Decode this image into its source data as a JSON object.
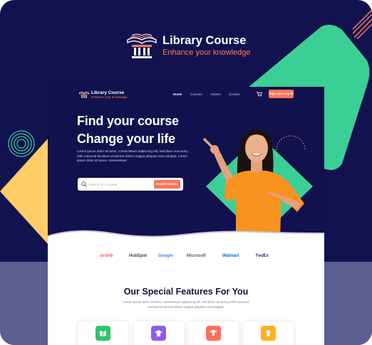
{
  "brand": {
    "title": "Library Course",
    "tagline": "Enhance your knowledge"
  },
  "site": {
    "logo_title": "Library Course",
    "logo_tagline": "Enhance your knowledge",
    "nav": [
      {
        "label": "Home",
        "active": true
      },
      {
        "label": "Courses",
        "active": false
      },
      {
        "label": "Articles",
        "active": false
      },
      {
        "label": "Contact",
        "active": false
      }
    ],
    "cart_icon": "cart-icon",
    "signup_label": "Sign Up / Log In",
    "hero": {
      "headline_line1": "Find your course",
      "headline_line2": "Change your life",
      "description": "Lorem ipsum dolor sit amet, consectetuer adipiscing elit, sed diam nonummy nibh euismod tincidunt ut laoreet dolore magna aliquam erat volutpat. Lorem ipsum dolor sit amet, consectetuer."
    },
    "search": {
      "placeholder": "Search for a course",
      "button_label": "Search Course"
    },
    "partners": [
      "airbnb",
      "HubSpot",
      "Google",
      "Microsoft",
      "Walmart",
      "FedEx"
    ],
    "features": {
      "title": "Our Special Features For You",
      "description": "Lorem ipsum dolor sit amet, consectetuer adipiscing elit, sed diam nonummy nibh euismod tincidunt ut laoreet dolore magna aliquam erat volutpat.",
      "cards": [
        {
          "icon": "book-icon",
          "color": "#2fc46b"
        },
        {
          "icon": "graduate-icon",
          "color": "#8b5cf6"
        },
        {
          "icon": "teacher-icon",
          "color": "#ff6f5e"
        },
        {
          "icon": "award-icon",
          "color": "#ffb020"
        }
      ]
    }
  },
  "colors": {
    "background": "#12124f",
    "accent": "#ff7459",
    "teal": "#3ccf95",
    "yellow": "#ffcc66"
  }
}
